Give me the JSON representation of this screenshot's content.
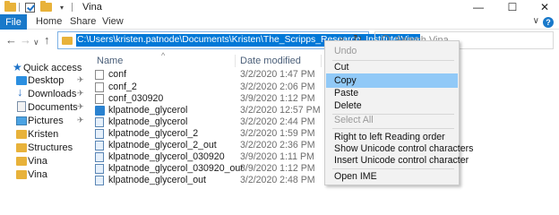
{
  "window": {
    "title": "Vina",
    "minimize_glyph": "—",
    "maximize_glyph": "☐",
    "close_glyph": "✕"
  },
  "ribbon": {
    "tabs": [
      {
        "label": "File"
      },
      {
        "label": "Home"
      },
      {
        "label": "Share"
      },
      {
        "label": "View"
      }
    ],
    "collapse_glyph": "∨",
    "help_glyph": "?"
  },
  "nav": {
    "back_glyph": "←",
    "forward_glyph": "→",
    "recent_glyph": "∨",
    "up_glyph": "↑",
    "address_path": "C:\\Users\\kristen.patnode\\Documents\\Kristen\\The_Scripps_Research_Institute\\Vina",
    "address_dropdown_glyph": "∨",
    "refresh_glyph": "↻",
    "search_placeholder": "Search Vina"
  },
  "sidebar": {
    "items": [
      {
        "label": "Quick access",
        "icon": "star-icon",
        "pinned": false
      },
      {
        "label": "Desktop",
        "icon": "desktop-icon",
        "pinned": true
      },
      {
        "label": "Downloads",
        "icon": "download-icon",
        "pinned": true
      },
      {
        "label": "Documents",
        "icon": "documents-icon",
        "pinned": true
      },
      {
        "label": "Pictures",
        "icon": "pictures-icon",
        "pinned": true
      },
      {
        "label": "Kristen",
        "icon": "folder-icon",
        "pinned": false
      },
      {
        "label": "Structures",
        "icon": "folder-icon",
        "pinned": false
      },
      {
        "label": "Vina",
        "icon": "folder-icon",
        "pinned": false
      },
      {
        "label": "Vina",
        "icon": "folder-icon",
        "pinned": false
      }
    ],
    "pin_glyph": "✈"
  },
  "file_list": {
    "columns": {
      "name": "Name",
      "date": "Date modified"
    },
    "sort_glyph": "^",
    "rows": [
      {
        "name": "conf",
        "date": "3/2/2020 1:47 PM",
        "icon": "text-file-icon"
      },
      {
        "name": "conf_2",
        "date": "3/2/2020 2:06 PM",
        "icon": "text-file-icon"
      },
      {
        "name": "conf_030920",
        "date": "3/9/2020 1:12 PM",
        "icon": "text-file-icon"
      },
      {
        "name": "klpatnode_glycerol",
        "date": "3/2/2020 12:57 PM",
        "icon": "vina-file-icon"
      },
      {
        "name": "klpatnode_glycerol",
        "date": "3/2/2020 2:44 PM",
        "icon": "molecule-file-icon"
      },
      {
        "name": "klpatnode_glycerol_2",
        "date": "3/2/2020 1:59 PM",
        "icon": "molecule-file-icon"
      },
      {
        "name": "klpatnode_glycerol_2_out",
        "date": "3/2/2020 2:36 PM",
        "icon": "molecule-file-icon"
      },
      {
        "name": "klpatnode_glycerol_030920",
        "date": "3/9/2020 1:11 PM",
        "icon": "molecule-file-icon"
      },
      {
        "name": "klpatnode_glycerol_030920_out",
        "date": "3/9/2020 1:12 PM",
        "icon": "molecule-file-icon"
      },
      {
        "name": "klpatnode_glycerol_out",
        "date": "3/2/2020 2:48 PM",
        "icon": "molecule-file-icon"
      }
    ]
  },
  "context_menu": {
    "items": [
      {
        "label": "Undo",
        "disabled": true,
        "highlighted": false
      },
      {
        "label": "Cut",
        "disabled": false,
        "highlighted": false
      },
      {
        "label": "Copy",
        "disabled": false,
        "highlighted": true
      },
      {
        "label": "Paste",
        "disabled": false,
        "highlighted": false
      },
      {
        "label": "Delete",
        "disabled": false,
        "highlighted": false
      },
      {
        "label": "Select All",
        "disabled": true,
        "highlighted": false
      },
      {
        "label": "Right to left Reading order",
        "disabled": false,
        "highlighted": false
      },
      {
        "label": "Show Unicode control characters",
        "disabled": false,
        "highlighted": false
      },
      {
        "label": "Insert Unicode control character",
        "disabled": false,
        "highlighted": false,
        "submenu": true
      },
      {
        "label": "Open IME",
        "disabled": false,
        "highlighted": false
      }
    ],
    "submenu_glyph": "›"
  },
  "colors": {
    "accent": "#0078d7",
    "file_tab": "#1979ca",
    "menu_highlight": "#91c9f7",
    "folder": "#e8b23a"
  }
}
